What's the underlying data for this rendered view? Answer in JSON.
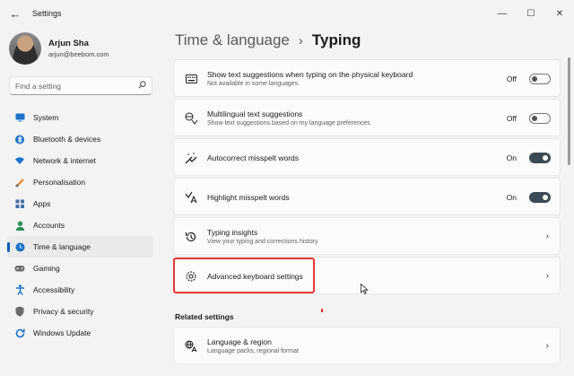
{
  "app": {
    "title": "Settings"
  },
  "profile": {
    "name": "Arjun Sha",
    "email": "arjun@beebom.com"
  },
  "search": {
    "placeholder": "Find a setting"
  },
  "nav": {
    "items": [
      {
        "label": "System",
        "icon": "monitor-icon",
        "color": "#1a73c8"
      },
      {
        "label": "Bluetooth & devices",
        "icon": "bluetooth-icon",
        "color": "#1a73c8"
      },
      {
        "label": "Network & internet",
        "icon": "wifi-icon",
        "color": "#1a73c8"
      },
      {
        "label": "Personalisation",
        "icon": "brush-icon",
        "color": "#d9822b"
      },
      {
        "label": "Apps",
        "icon": "apps-icon",
        "color": "#4a6ea9"
      },
      {
        "label": "Accounts",
        "icon": "person-icon",
        "color": "#2c8f5b"
      },
      {
        "label": "Time & language",
        "icon": "globe-clock-icon",
        "color": "#1a73c8"
      },
      {
        "label": "Gaming",
        "icon": "controller-icon",
        "color": "#6b6b6b"
      },
      {
        "label": "Accessibility",
        "icon": "accessibility-icon",
        "color": "#1a73c8"
      },
      {
        "label": "Privacy & security",
        "icon": "shield-icon",
        "color": "#6b6b6b"
      },
      {
        "label": "Windows Update",
        "icon": "update-icon",
        "color": "#1a73c8"
      }
    ],
    "active_index": 6,
    "accent": "#005fb8"
  },
  "breadcrumb": {
    "parent": "Time & language",
    "current": "Typing"
  },
  "settings": [
    {
      "title": "Show text suggestions when typing on the physical keyboard",
      "subtitle": "Not available in some languages",
      "state": "Off",
      "toggle": "off",
      "icon": "keyboard-icon"
    },
    {
      "title": "Multilingual text suggestions",
      "subtitle": "Show text suggestions based on my language preferences",
      "state": "Off",
      "toggle": "off",
      "icon": "multilingual-icon"
    },
    {
      "title": "Autocorrect misspelt words",
      "subtitle": "",
      "state": "On",
      "toggle": "on",
      "icon": "autocorrect-icon"
    },
    {
      "title": "Highlight misspelt words",
      "subtitle": "",
      "state": "On",
      "toggle": "on",
      "icon": "spellcheck-icon"
    },
    {
      "title": "Typing insights",
      "subtitle": "View your typing and corrections history",
      "icon": "history-icon"
    },
    {
      "title": "Advanced keyboard settings",
      "subtitle": "",
      "icon": "gear-icon"
    }
  ],
  "related": {
    "heading": "Related settings",
    "items": [
      {
        "title": "Language & region",
        "subtitle": "Language packs, regional format",
        "icon": "language-icon"
      }
    ]
  },
  "icons": {
    "back": "←",
    "min": "—",
    "max": "☐",
    "close": "✕",
    "search": "⌕",
    "chevron": "›"
  }
}
